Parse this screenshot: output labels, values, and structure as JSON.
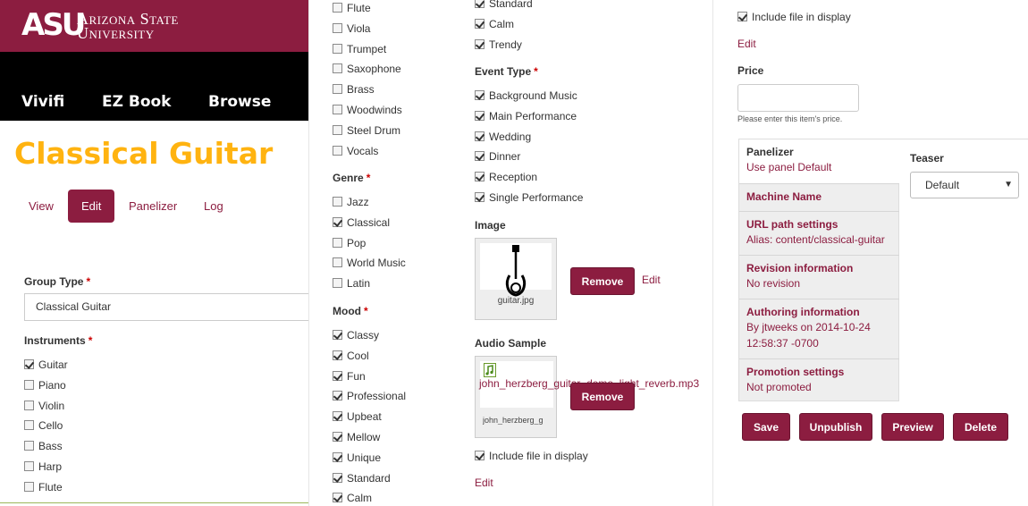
{
  "header": {
    "logo": "ASU",
    "university_line1": "Arizona State",
    "university_line2": "University",
    "nav": [
      "Vivifi",
      "EZ Book",
      "Browse"
    ]
  },
  "page": {
    "title": "Classical Guitar",
    "tabs": [
      "View",
      "Edit",
      "Panelizer",
      "Log"
    ],
    "active_tab": "Edit"
  },
  "form": {
    "group_type_label": "Group Type",
    "group_type_value": "Classical Guitar",
    "instruments_label": "Instruments",
    "instruments_col1": [
      {
        "label": "Guitar",
        "checked": true
      },
      {
        "label": "Piano",
        "checked": false
      },
      {
        "label": "Violin",
        "checked": false
      },
      {
        "label": "Cello",
        "checked": false
      },
      {
        "label": "Bass",
        "checked": false
      },
      {
        "label": "Harp",
        "checked": false
      },
      {
        "label": "Flute",
        "checked": false
      }
    ],
    "instruments_col2": [
      {
        "label": "Flute",
        "checked": false
      },
      {
        "label": "Viola",
        "checked": false
      },
      {
        "label": "Trumpet",
        "checked": false
      },
      {
        "label": "Saxophone",
        "checked": false
      },
      {
        "label": "Brass",
        "checked": false
      },
      {
        "label": "Woodwinds",
        "checked": false
      },
      {
        "label": "Steel Drum",
        "checked": false
      },
      {
        "label": "Vocals",
        "checked": false
      }
    ],
    "genre_label": "Genre",
    "genres": [
      {
        "label": "Jazz",
        "checked": false
      },
      {
        "label": "Classical",
        "checked": true
      },
      {
        "label": "Pop",
        "checked": false
      },
      {
        "label": "World Music",
        "checked": false
      },
      {
        "label": "Latin",
        "checked": false
      }
    ],
    "mood_label": "Mood",
    "moods": [
      {
        "label": "Classy",
        "checked": true
      },
      {
        "label": "Cool",
        "checked": true
      },
      {
        "label": "Fun",
        "checked": true
      },
      {
        "label": "Professional",
        "checked": true
      },
      {
        "label": "Upbeat",
        "checked": true
      },
      {
        "label": "Mellow",
        "checked": true
      },
      {
        "label": "Unique",
        "checked": true
      },
      {
        "label": "Standard",
        "checked": true
      },
      {
        "label": "Calm",
        "checked": true
      }
    ],
    "moods_continued": [
      {
        "label": "Standard",
        "checked": true
      },
      {
        "label": "Calm",
        "checked": true
      },
      {
        "label": "Trendy",
        "checked": true
      }
    ],
    "event_type_label": "Event Type",
    "event_types": [
      {
        "label": "Background Music",
        "checked": true
      },
      {
        "label": "Main Performance",
        "checked": true
      },
      {
        "label": "Wedding",
        "checked": true
      },
      {
        "label": "Dinner",
        "checked": true
      },
      {
        "label": "Reception",
        "checked": true
      },
      {
        "label": "Single Performance",
        "checked": true
      }
    ],
    "image_label": "Image",
    "image_filename": "guitar.jpg",
    "remove_label": "Remove",
    "edit_label": "Edit",
    "audio_label": "Audio Sample",
    "audio_filename": "john_herzberg_guitar_demo_light_reverb.mp3",
    "audio_thumb_caption": "john_herzberg_g",
    "include_file_label": "Include file in display",
    "include_file_checked": true,
    "price_label": "Price",
    "price_value": "",
    "price_help": "Please enter this item's price."
  },
  "vertical_tabs": [
    {
      "title": "Panelizer",
      "summary": "Use panel Default"
    },
    {
      "title": "Machine Name",
      "summary": ""
    },
    {
      "title": "URL path settings",
      "summary": "Alias: content/classical-guitar"
    },
    {
      "title": "Revision information",
      "summary": "No revision"
    },
    {
      "title": "Authoring information",
      "summary": "By jtweeks on 2014-10-24 12:58:37 -0700"
    },
    {
      "title": "Promotion settings",
      "summary": "Not promoted"
    }
  ],
  "panelizer_panel": {
    "teaser_label": "Teaser",
    "teaser_value": "Default"
  },
  "actions": [
    "Save",
    "Unpublish",
    "Preview",
    "Delete"
  ],
  "colors": {
    "asu_maroon": "#8c1d40",
    "asu_gold": "#ffb310",
    "nav_black": "#000000"
  }
}
